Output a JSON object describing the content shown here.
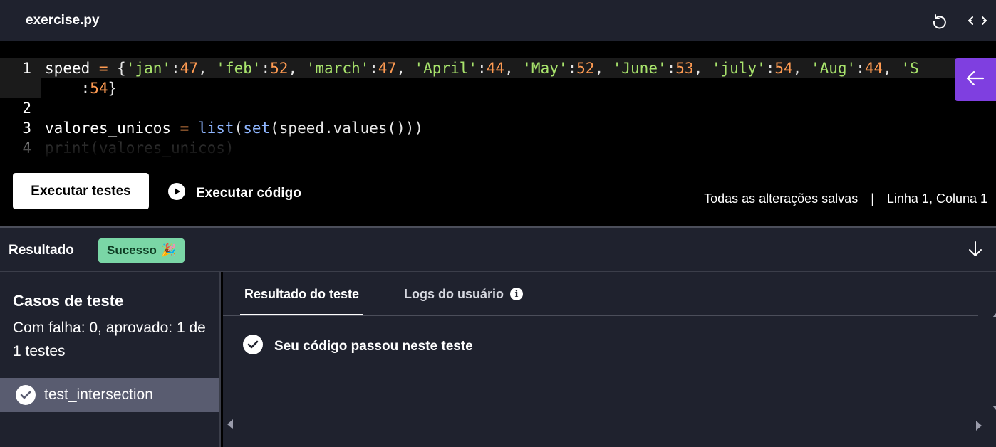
{
  "header": {
    "file_tab": "exercise.py",
    "reset_icon": "reset-icon",
    "expand_icon": "expand-horizontal-icon"
  },
  "editor": {
    "lines": [
      {
        "number": "1",
        "tokens": [
          {
            "t": "speed ",
            "c": "k"
          },
          {
            "t": "=",
            "c": "op"
          },
          {
            "t": " {",
            "c": "br"
          },
          {
            "t": "'jan'",
            "c": "str"
          },
          {
            "t": ":",
            "c": "br"
          },
          {
            "t": "47",
            "c": "num"
          },
          {
            "t": ", ",
            "c": "br"
          },
          {
            "t": "'feb'",
            "c": "str"
          },
          {
            "t": ":",
            "c": "br"
          },
          {
            "t": "52",
            "c": "num"
          },
          {
            "t": ", ",
            "c": "br"
          },
          {
            "t": "'march'",
            "c": "str"
          },
          {
            "t": ":",
            "c": "br"
          },
          {
            "t": "47",
            "c": "num"
          },
          {
            "t": ", ",
            "c": "br"
          },
          {
            "t": "'April'",
            "c": "str"
          },
          {
            "t": ":",
            "c": "br"
          },
          {
            "t": "44",
            "c": "num"
          },
          {
            "t": ", ",
            "c": "br"
          },
          {
            "t": "'May'",
            "c": "str"
          },
          {
            "t": ":",
            "c": "br"
          },
          {
            "t": "52",
            "c": "num"
          },
          {
            "t": ", ",
            "c": "br"
          },
          {
            "t": "'June'",
            "c": "str"
          },
          {
            "t": ":",
            "c": "br"
          },
          {
            "t": "53",
            "c": "num"
          },
          {
            "t": ", ",
            "c": "br"
          },
          {
            "t": "'july'",
            "c": "str"
          },
          {
            "t": ":",
            "c": "br"
          },
          {
            "t": "54",
            "c": "num"
          },
          {
            "t": ", ",
            "c": "br"
          },
          {
            "t": "'Aug'",
            "c": "str"
          },
          {
            "t": ":",
            "c": "br"
          },
          {
            "t": "44",
            "c": "num"
          },
          {
            "t": ", ",
            "c": "br"
          },
          {
            "t": "'S",
            "c": "str"
          }
        ]
      },
      {
        "number": "",
        "tokens": [
          {
            "t": "    ",
            "c": "br"
          },
          {
            "t": ":",
            "c": "br"
          },
          {
            "t": "54",
            "c": "num"
          },
          {
            "t": "}",
            "c": "br"
          }
        ]
      },
      {
        "number": "2",
        "tokens": []
      },
      {
        "number": "3",
        "tokens": [
          {
            "t": "valores_unicos ",
            "c": "k"
          },
          {
            "t": "=",
            "c": "op"
          },
          {
            "t": " ",
            "c": "br"
          },
          {
            "t": "list",
            "c": "fn"
          },
          {
            "t": "(",
            "c": "br"
          },
          {
            "t": "set",
            "c": "fn"
          },
          {
            "t": "(speed.values()))",
            "c": "br"
          }
        ]
      },
      {
        "number": "4",
        "tokens": [
          {
            "t": "print",
            "c": "dim"
          },
          {
            "t": "(valores_unicos)",
            "c": "dim"
          }
        ]
      }
    ],
    "collapse_panel_icon": "arrow-left-icon"
  },
  "actions": {
    "run_tests_label": "Executar testes",
    "run_code_label": "Executar código",
    "saved_status": "Todas as alterações salvas",
    "separator": "|",
    "cursor_position": "Linha 1, Coluna 1"
  },
  "results": {
    "title": "Resultado",
    "badge_label": "Sucesso",
    "badge_emoji": "🎉",
    "badge_color": "#7ad6a6",
    "collapse_icon": "arrow-down-icon"
  },
  "test_cases": {
    "title": "Casos de teste",
    "summary": "Com falha: 0, aprovado: 1 de 1 testes",
    "items": [
      {
        "name": "test_intersection",
        "status": "passed"
      }
    ]
  },
  "result_tabs": {
    "tabs": [
      {
        "label": "Resultado do teste",
        "active": true
      },
      {
        "label": "Logs do usuário",
        "active": false
      }
    ],
    "message": "Seu código passou neste teste"
  },
  "colors": {
    "accent_purple": "#7f3fe0",
    "panel_bg": "#1f222e",
    "selected_item_bg": "#595c70"
  }
}
